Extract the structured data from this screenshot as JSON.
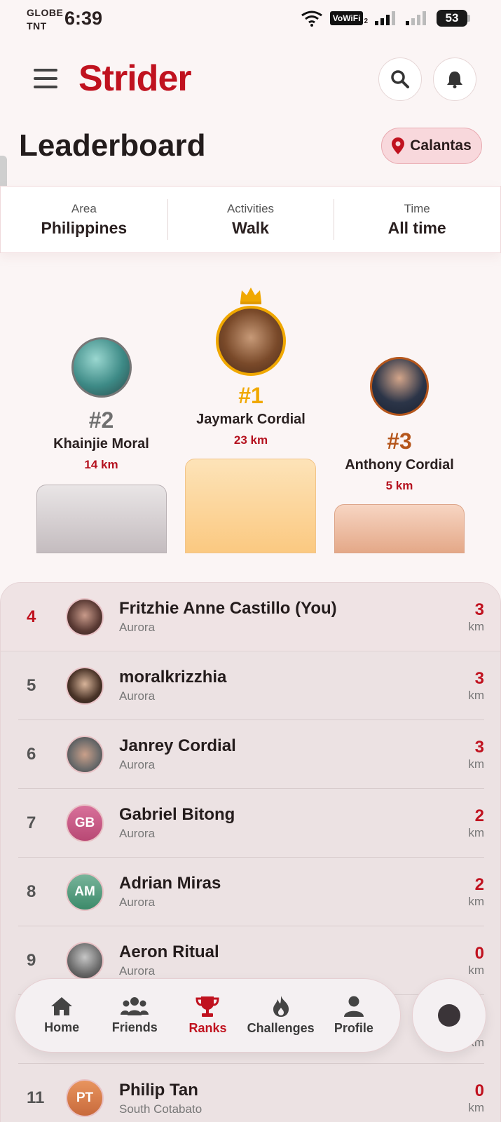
{
  "status_bar": {
    "carrier_1": "GLOBE",
    "carrier_2": "TNT",
    "time": "6:39",
    "vowifi": "VoWiFi",
    "sim_index": "2",
    "battery": "53"
  },
  "header": {
    "app_title": "Strider",
    "page_title": "Leaderboard",
    "location": "Calantas"
  },
  "filters": [
    {
      "label": "Area",
      "value": "Philippines"
    },
    {
      "label": "Activities",
      "value": "Walk"
    },
    {
      "label": "Time",
      "value": "All time"
    }
  ],
  "podium": {
    "first": {
      "rank": "#1",
      "name": "Jaymark Cordial",
      "distance": "23 km"
    },
    "second": {
      "rank": "#2",
      "name": "Khainjie Moral",
      "distance": "14 km"
    },
    "third": {
      "rank": "#3",
      "name": "Anthony Cordial",
      "distance": "5 km"
    }
  },
  "rows": [
    {
      "rank": "4",
      "name": "Fritzhie Anne Castillo (You)",
      "location": "Aurora",
      "value": "3",
      "unit": "km"
    },
    {
      "rank": "5",
      "name": "moralkrizzhia",
      "location": "Aurora",
      "value": "3",
      "unit": "km"
    },
    {
      "rank": "6",
      "name": "Janrey Cordial",
      "location": "Aurora",
      "value": "3",
      "unit": "km"
    },
    {
      "rank": "7",
      "name": "Gabriel Bitong",
      "location": "Aurora",
      "value": "2",
      "unit": "km",
      "initials": "GB"
    },
    {
      "rank": "8",
      "name": "Adrian Miras",
      "location": "Aurora",
      "value": "2",
      "unit": "km",
      "initials": "AM"
    },
    {
      "rank": "9",
      "name": "Aeron Ritual",
      "location": "Aurora",
      "value": "0",
      "unit": "km"
    },
    {
      "rank": "11",
      "name": "Philip Tan",
      "location": "South Cotabato",
      "value": "0",
      "unit": "km",
      "initials": "PT"
    }
  ],
  "partial_row_unit": "km",
  "nav": {
    "home": "Home",
    "friends": "Friends",
    "ranks": "Ranks",
    "challenges": "Challenges",
    "profile": "Profile"
  },
  "colors": {
    "brand": "#c0121f",
    "gold": "#f0a800",
    "silver": "#7a7a7a",
    "bronze": "#b5561c"
  }
}
